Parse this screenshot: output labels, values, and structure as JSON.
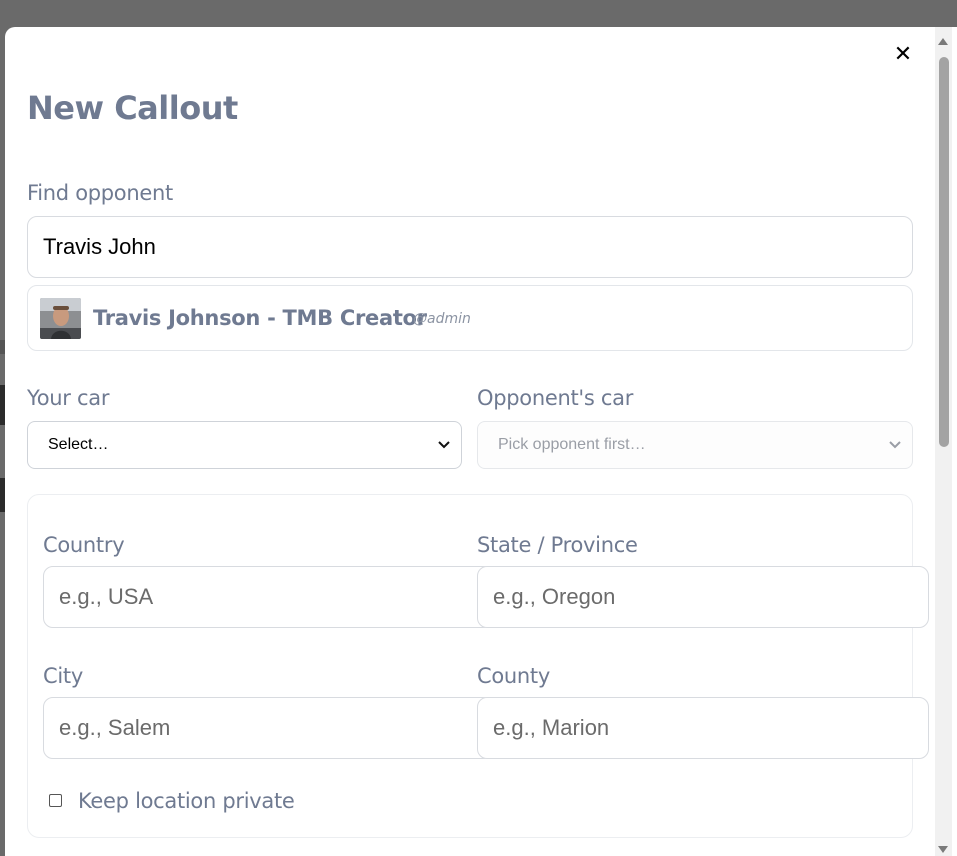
{
  "modal": {
    "title": "New Callout",
    "close_label": "✕"
  },
  "find_opponent": {
    "label": "Find opponent",
    "value": "Travis John"
  },
  "search_result": {
    "name": "Travis Johnson - TMB Creator",
    "handle": "@admin"
  },
  "your_car": {
    "label": "Your car",
    "selected": "Select…"
  },
  "opponent_car": {
    "label": "Opponent's car",
    "selected": "Pick opponent first…",
    "disabled": true
  },
  "location": {
    "country": {
      "label": "Country",
      "placeholder": "e.g., USA"
    },
    "state": {
      "label": "State / Province",
      "placeholder": "e.g., Oregon"
    },
    "city": {
      "label": "City",
      "placeholder": "e.g., Salem"
    },
    "county": {
      "label": "County",
      "placeholder": "e.g., Marion"
    },
    "private_label": "Keep location private",
    "private_checked": false
  },
  "colors": {
    "label_text": "#6f7a91",
    "overlay": "#6a6a6a",
    "border": "#d8dbe0"
  },
  "icons": [
    "close-icon",
    "chevron-down-icon",
    "avatar-image",
    "scroll-up-arrow",
    "scroll-down-arrow"
  ]
}
